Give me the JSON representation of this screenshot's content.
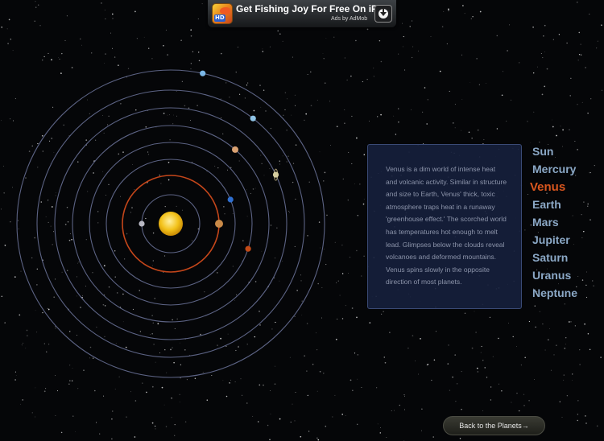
{
  "ad": {
    "title": "Get Fishing Joy For Free On iPad",
    "subtitle": "Ads by AdMob",
    "app_icon_badge": "HD",
    "icon": "download-icon"
  },
  "info": {
    "planet": "Venus",
    "text": "Venus is a dim world of intense heat and volcanic activity. Similar in structure and size to Earth, Venus' thick, toxic atmosphere traps heat in a runaway 'greenhouse effect.' The scorched world has temperatures hot enough to melt lead. Glimpses below the clouds reveal volcanoes and deformed mountains. Venus spins slowly in the opposite direction of most planets."
  },
  "planets": {
    "selected": "Venus",
    "items": [
      {
        "key": "sun",
        "label": "Sun"
      },
      {
        "key": "mercury",
        "label": "Mercury"
      },
      {
        "key": "venus",
        "label": "Venus"
      },
      {
        "key": "earth",
        "label": "Earth"
      },
      {
        "key": "mars",
        "label": "Mars"
      },
      {
        "key": "jupiter",
        "label": "Jupiter"
      },
      {
        "key": "saturn",
        "label": "Saturn"
      },
      {
        "key": "uranus",
        "label": "Uranus"
      },
      {
        "key": "neptune",
        "label": "Neptune"
      }
    ]
  },
  "colors": {
    "orbit": "#5c6384",
    "selected_orbit": "#c4461a",
    "sun": "#f3c21a",
    "mercury": "#b9b9c4",
    "venus": "#c98a48",
    "earth": "#2f6fd0",
    "mars": "#c24a17",
    "jupiter": "#d9a172",
    "saturn": "#d8cfa0",
    "uranus": "#8fc4e6",
    "neptune": "#7bb8e8"
  },
  "back_button": {
    "label": "Back to the Planets→"
  }
}
